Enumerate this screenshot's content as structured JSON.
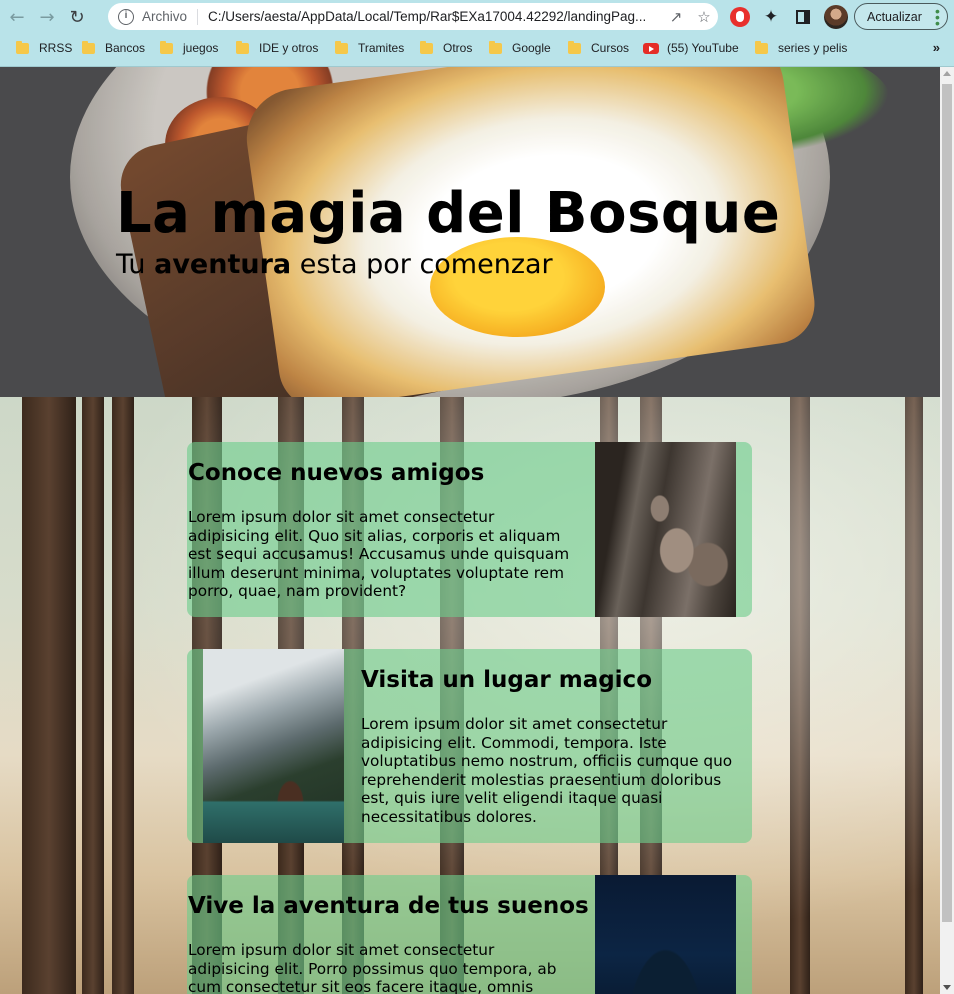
{
  "browser": {
    "site_chip": "Archivo",
    "url": "C:/Users/aesta/AppData/Local/Temp/Rar$EXa17004.42292/landingPag...",
    "update_button": "Actualizar",
    "bookmarks": [
      {
        "label": "RRSS",
        "icon": "folder-icon"
      },
      {
        "label": "Bancos",
        "icon": "folder-icon"
      },
      {
        "label": "juegos",
        "icon": "folder-icon"
      },
      {
        "label": "IDE y otros",
        "icon": "folder-icon"
      },
      {
        "label": "Tramites",
        "icon": "folder-icon"
      },
      {
        "label": "Otros",
        "icon": "folder-icon"
      },
      {
        "label": "Google",
        "icon": "folder-icon"
      },
      {
        "label": "Cursos",
        "icon": "folder-icon"
      },
      {
        "label": "(55) YouTube",
        "icon": "youtube-icon"
      },
      {
        "label": "series y pelis",
        "icon": "folder-icon"
      }
    ],
    "bookmarks_overflow": "»"
  },
  "hero": {
    "title": "La magia del Bosque",
    "subtitle_before": "Tu ",
    "subtitle_bold": "aventura",
    "subtitle_after": " esta por comenzar"
  },
  "cards": [
    {
      "title": "Conoce nuevos amigos",
      "text": "Lorem ipsum dolor sit amet consectetur adipisicing elit. Quo sit alias, corporis et aliquam est sequi accusamus! Accusamus unde quisquam illum deserunt minima, voluptates voluptate rem porro, quae, nam provident?",
      "image": "squirrel-photo"
    },
    {
      "title": "Visita un lugar magico",
      "text": "Lorem ipsum dolor sit amet consectetur adipisicing elit. Commodi, tempora. Iste voluptatibus nemo nostrum, officiis cumque quo reprehenderit molestias praesentium doloribus est, quis iure velit eligendi itaque quasi necessitatibus dolores.",
      "image": "mountain-lake-photo"
    },
    {
      "title": "Vive la aventura de tus suenos",
      "text": "Lorem ipsum dolor sit amet consectetur adipisicing elit. Porro possimus quo tempora, ab cum consectetur sit eos facere itaque, omnis",
      "image": "night-sky-photo"
    }
  ]
}
